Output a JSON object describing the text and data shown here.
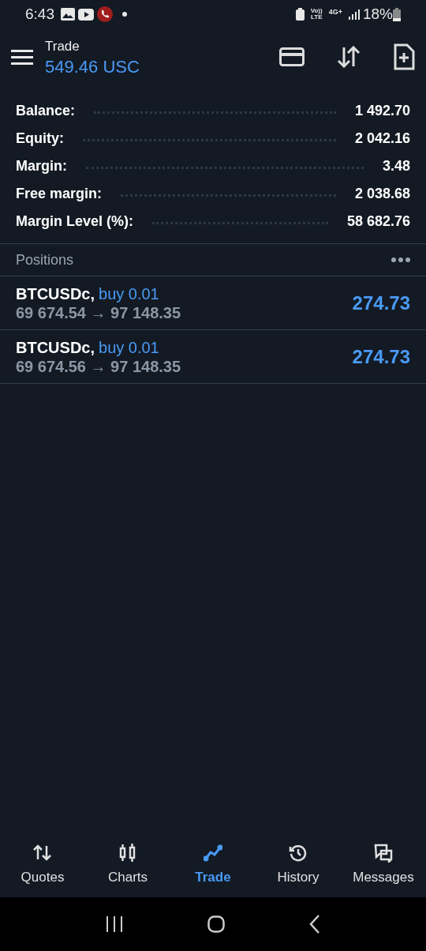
{
  "status_bar": {
    "time": "6:43",
    "network": [
      "Vo))",
      "LTE",
      "4G+"
    ],
    "battery": "18%"
  },
  "header": {
    "title": "Trade",
    "balance": "549.46 USC"
  },
  "summary": [
    {
      "label": "Balance:",
      "value": "1 492.70"
    },
    {
      "label": "Equity:",
      "value": "2 042.16"
    },
    {
      "label": "Margin:",
      "value": "3.48"
    },
    {
      "label": "Free margin:",
      "value": "2 038.68"
    },
    {
      "label": "Margin Level (%):",
      "value": "58 682.76"
    }
  ],
  "positions": {
    "title": "Positions",
    "rows": [
      {
        "symbol": "BTCUSDc,",
        "side": "buy 0.01",
        "prices": "69 674.54 → 97 148.35",
        "profit": "274.73"
      },
      {
        "symbol": "BTCUSDc,",
        "side": "buy 0.01",
        "prices": "69 674.56 → 97 148.35",
        "profit": "274.73"
      }
    ]
  },
  "tabs": [
    {
      "label": "Quotes",
      "kind": "quotes",
      "selected": false
    },
    {
      "label": "Charts",
      "kind": "charts",
      "selected": false
    },
    {
      "label": "Trade",
      "kind": "trade",
      "selected": true
    },
    {
      "label": "History",
      "kind": "history",
      "selected": false
    },
    {
      "label": "Messages",
      "kind": "messages",
      "selected": false
    }
  ]
}
